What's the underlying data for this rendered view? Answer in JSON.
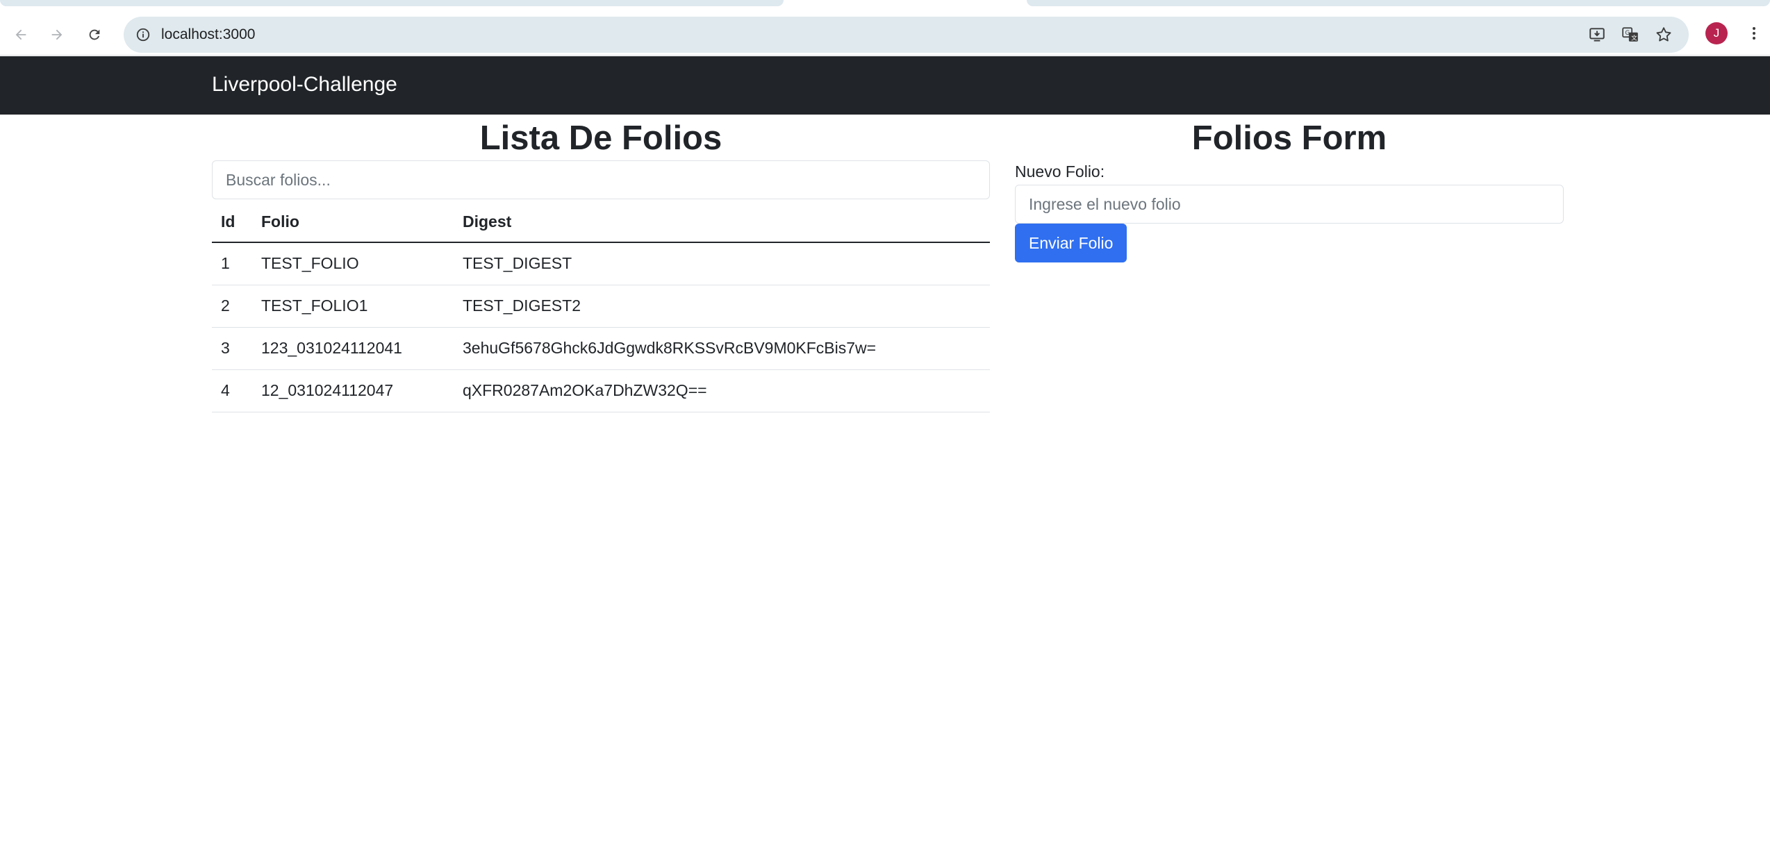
{
  "browser": {
    "url": "localhost:3000",
    "profile_initial": "J",
    "profile_color": "#b8244f"
  },
  "navbar": {
    "brand": "Liverpool-Challenge",
    "background": "#212529"
  },
  "list": {
    "title": "Lista De Folios",
    "search_placeholder": "Buscar folios...",
    "columns": [
      "Id",
      "Folio",
      "Digest"
    ],
    "rows": [
      {
        "id": "1",
        "folio": "TEST_FOLIO",
        "digest": "TEST_DIGEST"
      },
      {
        "id": "2",
        "folio": "TEST_FOLIO1",
        "digest": "TEST_DIGEST2"
      },
      {
        "id": "3",
        "folio": "123_031024112041",
        "digest": "3ehuGf5678Ghck6JdGgwdk8RKSSvRcBV9M0KFcBis7w="
      },
      {
        "id": "4",
        "folio": "12_031024112047",
        "digest": "qXFR0287Am2OKa7DhZW32Q=="
      }
    ]
  },
  "form": {
    "title": "Folios Form",
    "label": "Nuevo Folio:",
    "input_placeholder": "Ingrese el nuevo folio",
    "submit_label": "Enviar Folio",
    "accent": "#2f6ff0"
  }
}
